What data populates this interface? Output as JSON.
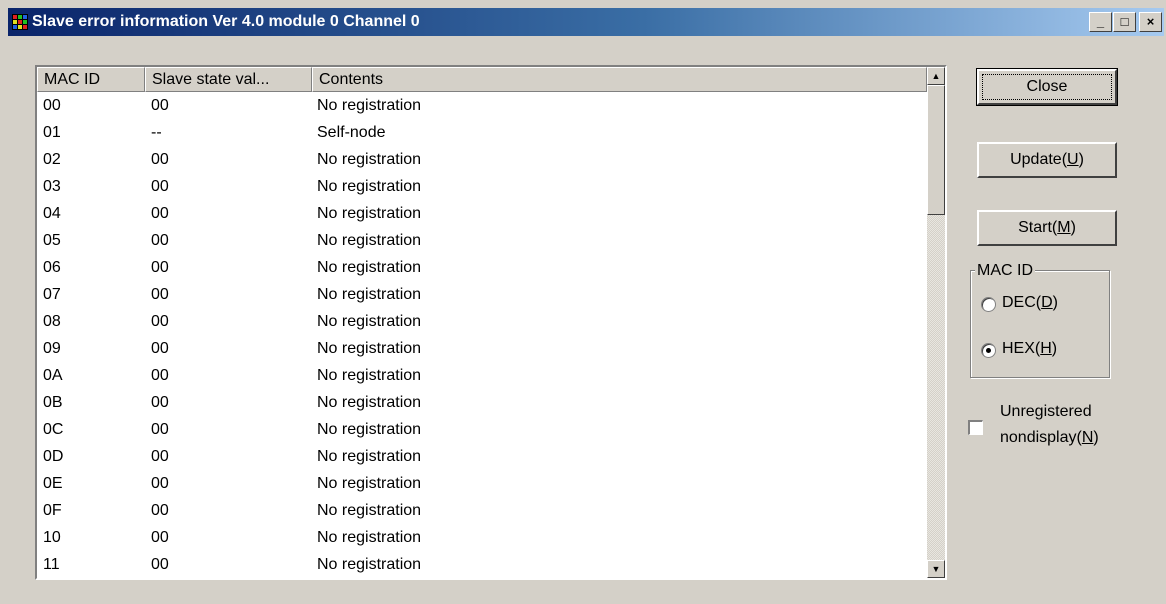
{
  "window": {
    "title": "Slave error information Ver 4.0 module 0 Channel 0",
    "controls": {
      "minimize": "_",
      "maximize": "□",
      "close": "×"
    }
  },
  "table": {
    "columns": [
      "MAC ID",
      "Slave state val...",
      "Contents"
    ],
    "rows": [
      [
        "00",
        "00",
        "No registration"
      ],
      [
        "01",
        "--",
        "Self-node"
      ],
      [
        "02",
        "00",
        "No registration"
      ],
      [
        "03",
        "00",
        "No registration"
      ],
      [
        "04",
        "00",
        "No registration"
      ],
      [
        "05",
        "00",
        "No registration"
      ],
      [
        "06",
        "00",
        "No registration"
      ],
      [
        "07",
        "00",
        "No registration"
      ],
      [
        "08",
        "00",
        "No registration"
      ],
      [
        "09",
        "00",
        "No registration"
      ],
      [
        "0A",
        "00",
        "No registration"
      ],
      [
        "0B",
        "00",
        "No registration"
      ],
      [
        "0C",
        "00",
        "No registration"
      ],
      [
        "0D",
        "00",
        "No registration"
      ],
      [
        "0E",
        "00",
        "No registration"
      ],
      [
        "0F",
        "00",
        "No registration"
      ],
      [
        "10",
        "00",
        "No registration"
      ],
      [
        "11",
        "00",
        "No registration"
      ]
    ]
  },
  "buttons": {
    "close": "Close",
    "update": {
      "text": "Update(",
      "key": "U",
      "end": ")"
    },
    "start": {
      "text": "Start(",
      "key": "M",
      "end": ")"
    }
  },
  "mac_id_group": {
    "label": "MAC ID",
    "dec": {
      "text": "DEC(",
      "key": "D",
      "end": ")",
      "selected": false
    },
    "hex": {
      "text": "HEX(",
      "key": "H",
      "end": ")",
      "selected": true
    }
  },
  "unregistered": {
    "line1": "Unregistered",
    "line2_text": "nondisplay(",
    "line2_key": "N",
    "line2_end": ")",
    "checked": false
  },
  "colors": {
    "title_start": "#0a246a",
    "title_end": "#a6caf0",
    "face": "#d4d0c8"
  }
}
